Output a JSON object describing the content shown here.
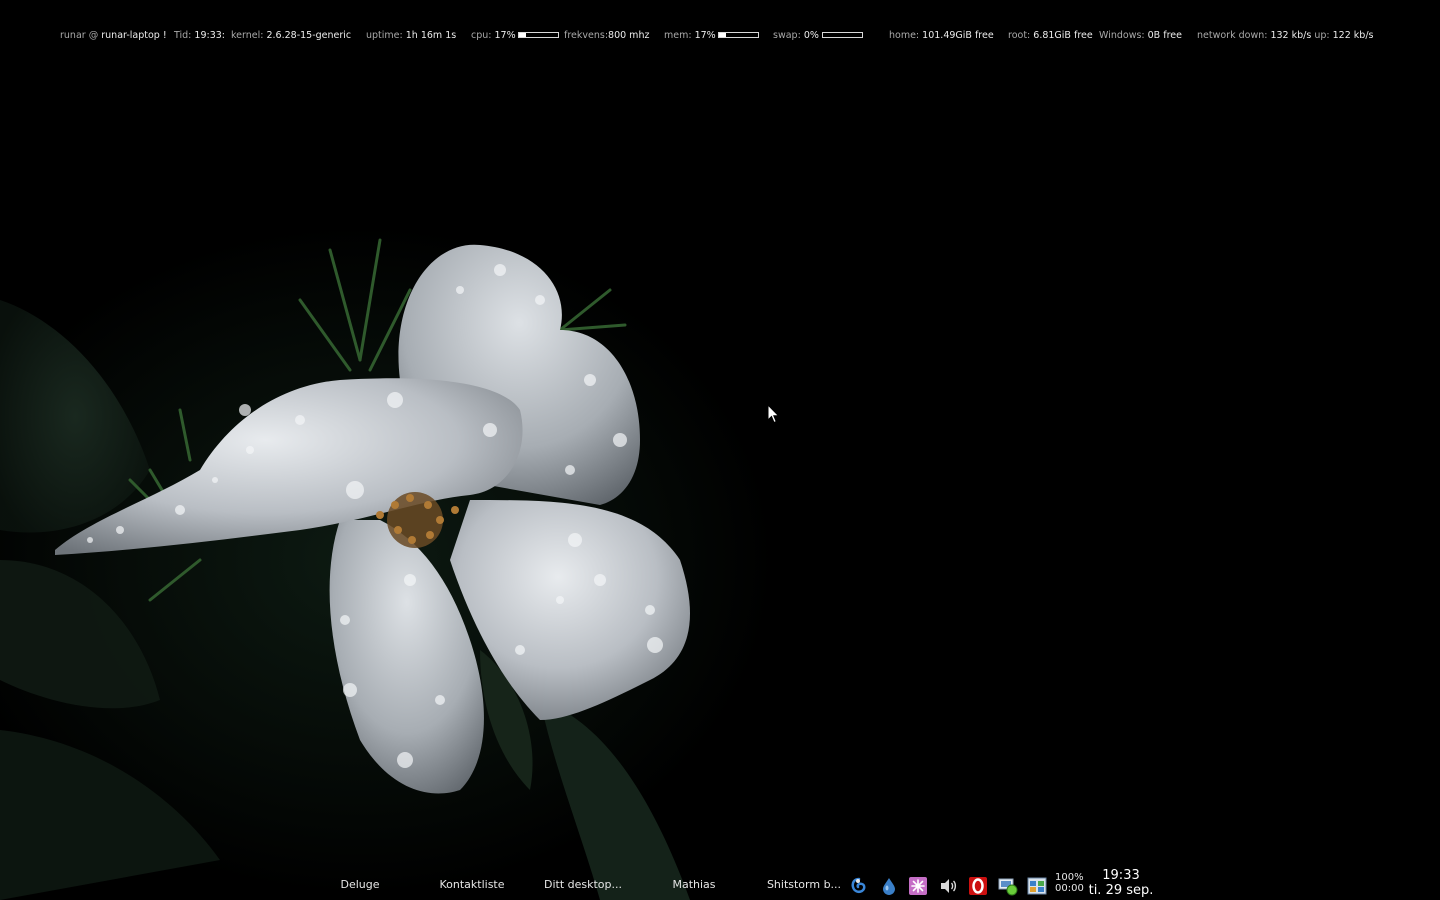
{
  "conky": {
    "user": "runar",
    "at": "@",
    "host": "runar-laptop !",
    "time_label": "Tid:",
    "time_value": "19:33:",
    "kernel_label": "kernel:",
    "kernel_value": "2.6.28-15-generic",
    "uptime_label": "uptime:",
    "uptime_value": "1h 16m 1s",
    "cpu_label": "cpu:",
    "cpu_value": "17%",
    "cpu_fraction": 0.17,
    "freq_label": "frekvens:",
    "freq_value": "800 mhz",
    "mem_label": "mem:",
    "mem_value": "17%",
    "mem_fraction": 0.17,
    "swap_label": "swap:",
    "swap_value": "0%",
    "swap_fraction": 0.0,
    "home_label": "home:",
    "home_value": "101.49GiB free",
    "root_label": "root:",
    "root_value": "6.81GiB free",
    "windows_label": "Windows:",
    "windows_value": "0B free",
    "net_down_label": "network down:",
    "net_down_value": "132 kb/s",
    "net_up_label": "up:",
    "net_up_value": "122 kb/s"
  },
  "taskbar": {
    "tasks": [
      {
        "label": "Deluge"
      },
      {
        "label": "Kontaktliste"
      },
      {
        "label": "Ditt desktop..."
      },
      {
        "label": "Mathias"
      },
      {
        "label": "Shitstorm b..."
      }
    ]
  },
  "tray": {
    "icons": [
      "blue-swirl-icon",
      "water-drop-icon",
      "pink-settings-icon",
      "volume-icon",
      "opera-icon",
      "network-icon",
      "windows-manager-icon"
    ],
    "battery_percent": "100%",
    "battery_time": "00:00"
  },
  "clock": {
    "time": "19:33",
    "date": "ti. 29 sep."
  },
  "colors": {
    "conky_label": "#a9a9a9",
    "conky_value": "#ececec",
    "taskbar_text": "#e6e6e6",
    "opera_red": "#cc1010"
  }
}
